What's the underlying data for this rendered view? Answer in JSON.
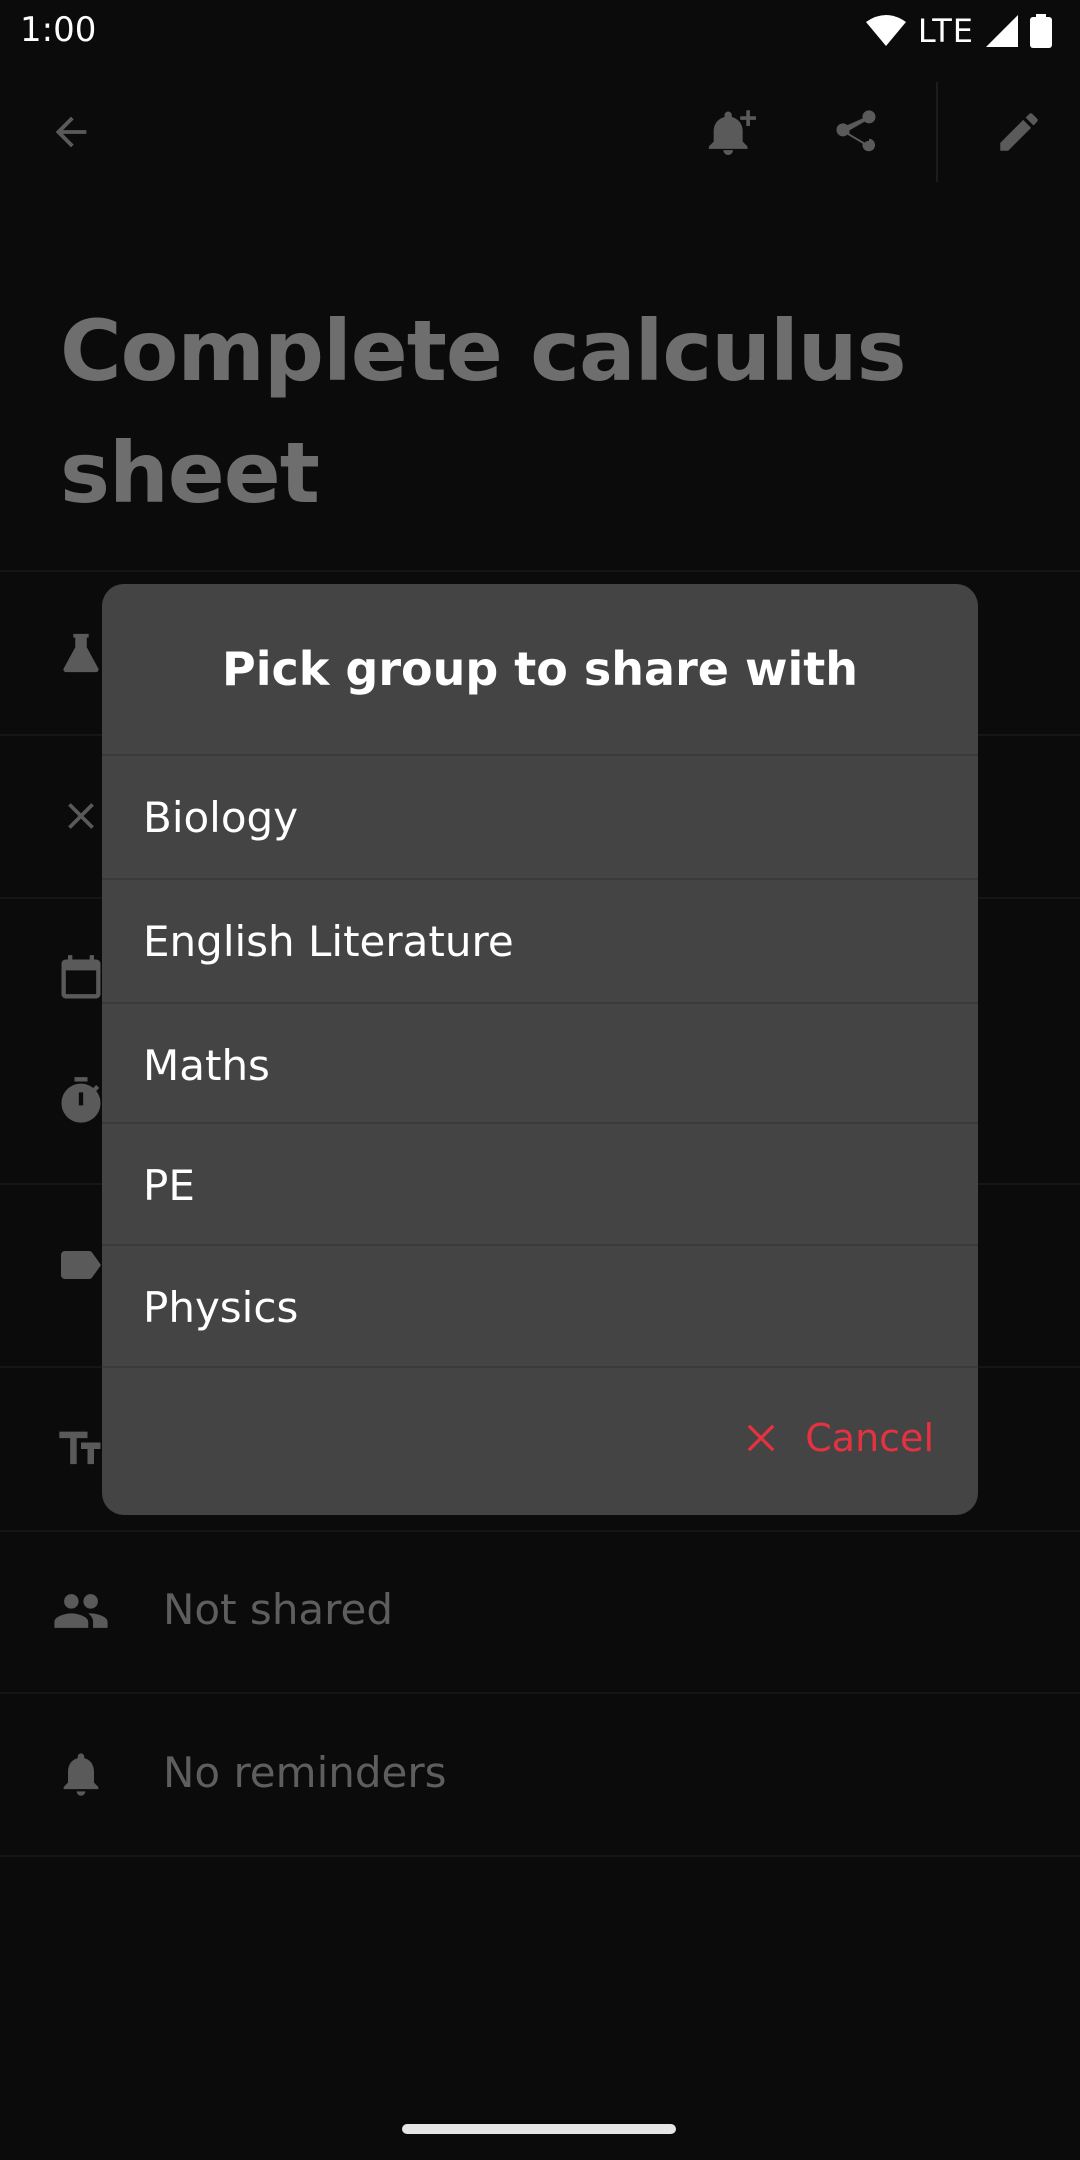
{
  "status_bar": {
    "time": "1:00",
    "network": "LTE",
    "icons": [
      "wifi-icon",
      "signal-icon",
      "battery-icon"
    ]
  },
  "toolbar": {
    "icons": [
      "back-arrow-icon",
      "add-reminder-bell-icon",
      "share-icon",
      "edit-pencil-icon"
    ]
  },
  "task": {
    "title": "Complete calculus sheet"
  },
  "details": {
    "shared_label": "Not shared",
    "reminders_label": "No reminders",
    "icons": [
      "flask-icon",
      "close-icon",
      "calendar-icon",
      "timer-icon",
      "label-icon",
      "text-format-icon",
      "people-icon",
      "bell-icon"
    ]
  },
  "dialog": {
    "title": "Pick group to share with",
    "groups": [
      "Biology",
      "English Literature",
      "Maths",
      "PE",
      "Physics"
    ],
    "cancel_label": "Cancel"
  },
  "colors": {
    "background": "#0b0b0b",
    "dialog": "#444444",
    "accent_red": "#e53240",
    "dim_text": "#5e5e5e"
  }
}
